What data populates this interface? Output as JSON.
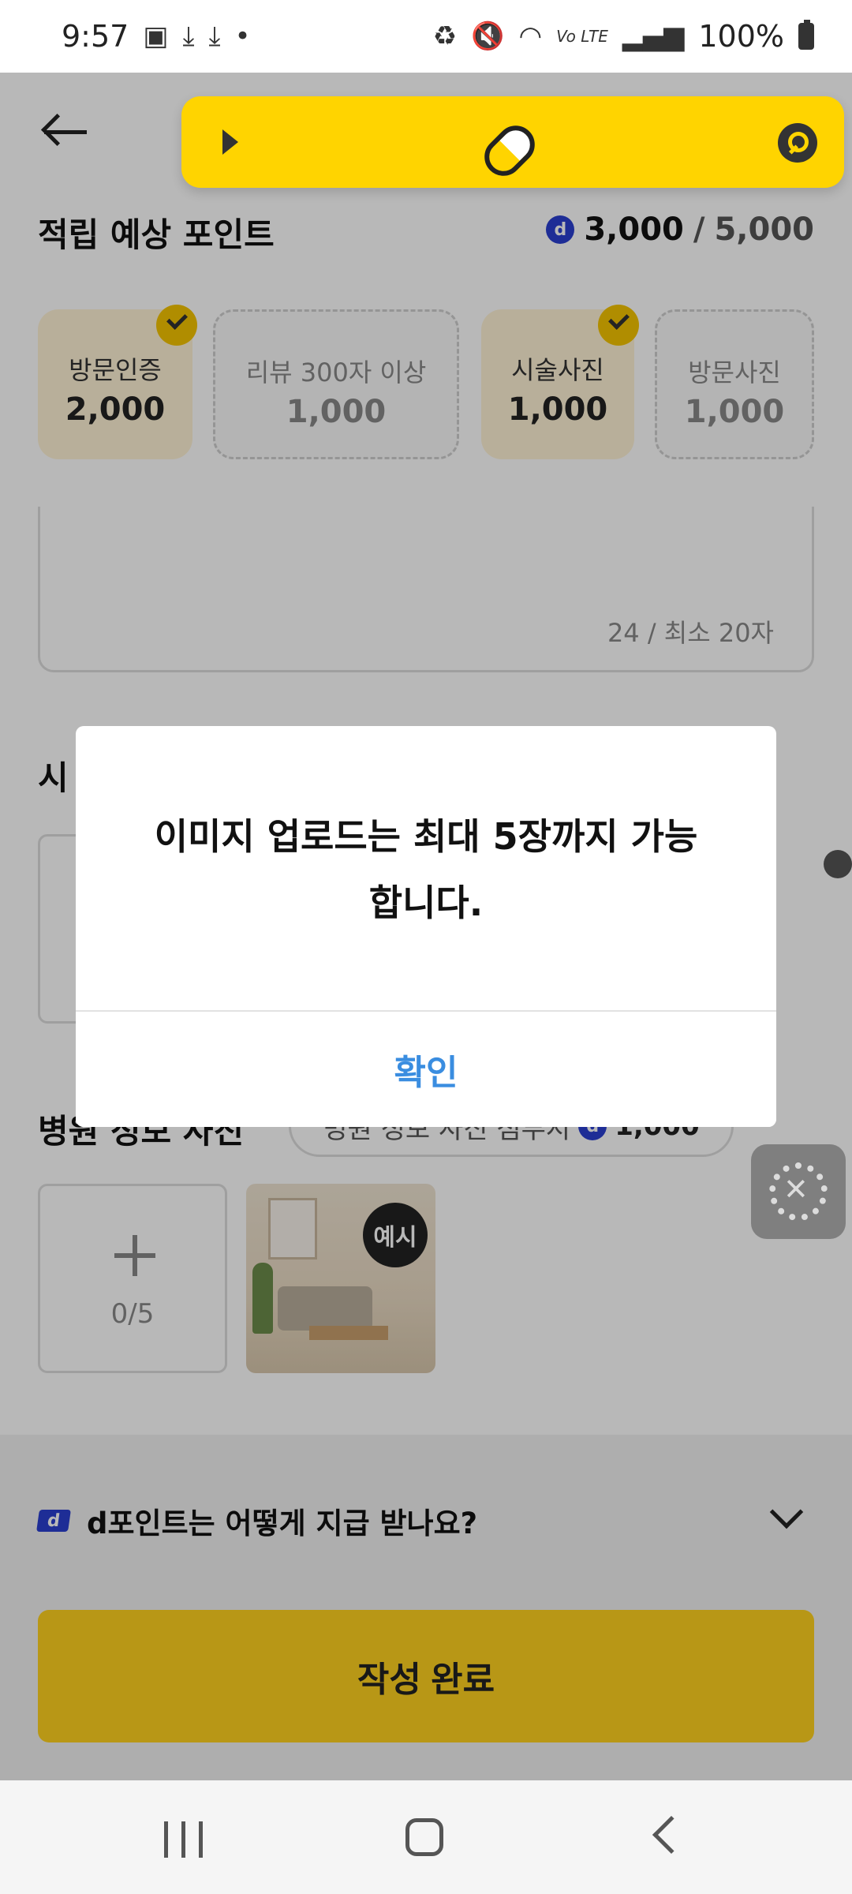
{
  "status_bar": {
    "time": "9:57",
    "left_icons": [
      "gallery-icon",
      "download-icon",
      "download-icon",
      "dot-icon"
    ],
    "right_icons": [
      "battery-saver-icon",
      "mute-icon",
      "wifi-icon",
      "volte-icon",
      "signal-icon"
    ],
    "volte_label": "Vo LTE",
    "battery": "100%"
  },
  "floating_bar": {
    "color": "#ffd400",
    "icons": [
      "play-icon",
      "pill-icon",
      "search-icon"
    ]
  },
  "header": {
    "section_title": "적립 예상 포인트",
    "points_current": "3,000",
    "points_separator": "/",
    "points_max": "5,000",
    "coin_label": "d"
  },
  "chips": [
    {
      "label": "방문인증",
      "value": "2,000",
      "checked": true
    },
    {
      "label": "리뷰 300자 이상",
      "value": "1,000",
      "checked": false
    },
    {
      "label": "시술사진",
      "value": "1,000",
      "checked": true
    },
    {
      "label": "방문사진",
      "value": "1,000",
      "checked": false
    }
  ],
  "review": {
    "char_count": "24 / 최소 20자"
  },
  "section2": {
    "title_visible": "시"
  },
  "section3": {
    "title": "병원 정보 사진",
    "reward_label": "병원 정보 사진 첨부시",
    "reward_points": "1,000",
    "upload_count": "0/5",
    "example_badge": "예시"
  },
  "faq": {
    "logo": "d",
    "question": "d포인트는 어떻게 지급 받나요?"
  },
  "submit": {
    "label": "작성 완료",
    "color": "#ffd21f"
  },
  "modal": {
    "message_line1": "이미지 업로드는 최대 5장까지 가능",
    "message_line2": "합니다.",
    "confirm_label": "확인",
    "confirm_color": "#3a8de0"
  }
}
